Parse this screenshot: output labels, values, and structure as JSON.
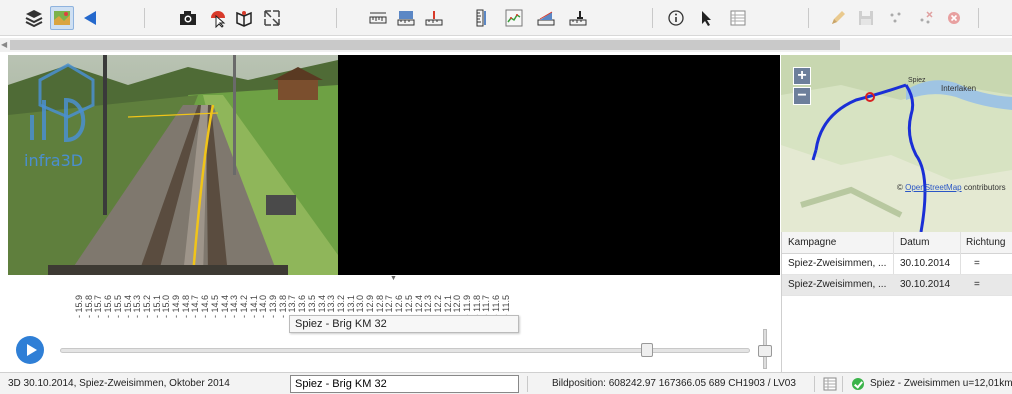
{
  "toolbar": {
    "icons": [
      "layers-icon",
      "map-icon",
      "back-arrow-icon",
      "camera-icon",
      "point-cloud-pick-icon",
      "3d-view-icon",
      "expand-icon",
      "measure-horizontal-icon",
      "measure-area-icon",
      "measure-vertical-icon",
      "measure-height-icon",
      "profile-icon",
      "slope-icon",
      "level-icon",
      "info-icon",
      "pointer-icon",
      "table-icon",
      "edit-icon",
      "save-icon",
      "points-icon",
      "delete-points-icon",
      "cancel-icon"
    ]
  },
  "video": {
    "logo_text": "infra3D"
  },
  "map": {
    "zoom_in": "+",
    "zoom_out": "−",
    "city_label": "Interlaken",
    "town_label": "Spiez",
    "credit_prefix": "© ",
    "credit_link": "OpenStreetMap",
    "credit_suffix": " contributors"
  },
  "table": {
    "headers": [
      "Kampagne",
      "Datum",
      "Richtung"
    ],
    "rows": [
      {
        "kampagne": "Spiez-Zweisimmen, ...",
        "datum": "30.10.2014",
        "richtung": "="
      },
      {
        "kampagne": "Spiez-Zweisimmen, ...",
        "datum": "30.10.2014",
        "richtung": "="
      }
    ]
  },
  "timeline": {
    "ticks": [
      "- 15.9",
      "- 15.8",
      "- 15.7",
      "- 15.6",
      "- 15.5",
      "- 15.4",
      "- 15.3",
      "- 15.2",
      "- 15.1",
      "- 15.0",
      "- 14.9",
      "- 14.8",
      "- 14.7",
      "- 14.6",
      "- 14.5",
      "- 14.4",
      "- 14.3",
      "- 14.2",
      "- 14.1",
      "- 14.0",
      "- 13.9",
      "- 13.8",
      "- 13.7",
      "- 13.6",
      "- 13.5",
      "- 13.4",
      "- 13.3",
      "- 13.2",
      "- 13.1",
      "- 13.0",
      "- 12.9",
      "- 12.8",
      "- 12.7",
      "- 12.6",
      "- 12.5",
      "- 12.4",
      "- 12.3",
      "- 12.2",
      "- 12.1",
      "- 12.0",
      "- 11.9",
      "- 11.8",
      "- 11.7",
      "- 11.6",
      "- 11.5"
    ],
    "tooltip": "Spiez - Brig KM 32",
    "slider_position": 0.85
  },
  "statusbar": {
    "campaign_text": "3D  30.10.2014, Spiez-Zweisimmen, Oktober 2014",
    "route_value": "Spiez - Brig KM 32",
    "position_text": "Bildposition: 608242.97 167366.05 689  CH1903 / LV03",
    "status_text": "Spiez - Zweisimmen u=12,01km"
  },
  "colors": {
    "accent": "#2f7fd6",
    "route_line": "#1a2fd6",
    "ok": "#3bb34a"
  }
}
